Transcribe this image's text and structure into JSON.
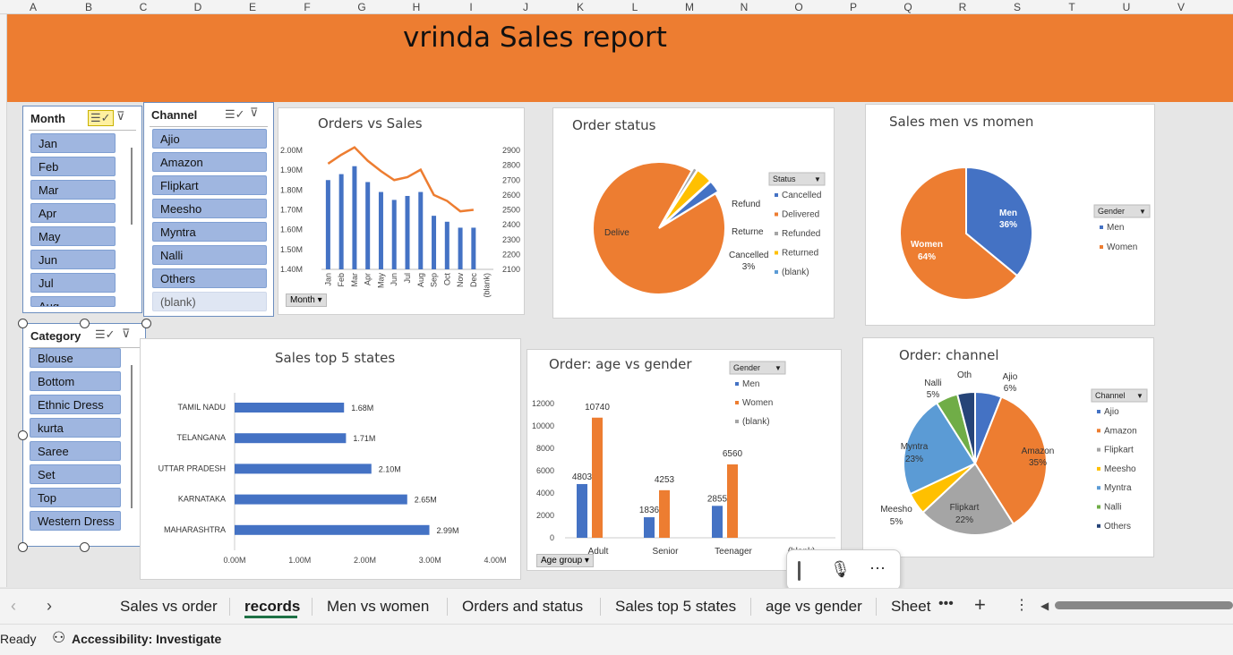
{
  "columns": [
    "A",
    "B",
    "C",
    "D",
    "E",
    "F",
    "G",
    "H",
    "I",
    "J",
    "K",
    "L",
    "M",
    "N",
    "O",
    "P",
    "Q",
    "R",
    "S",
    "T",
    "U",
    "V"
  ],
  "title": "vrinda Sales report",
  "slicers": {
    "month": {
      "title": "Month",
      "items": [
        "Jan",
        "Feb",
        "Mar",
        "Apr",
        "May",
        "Jun",
        "Jul",
        "Aug"
      ]
    },
    "channel": {
      "title": "Channel",
      "items": [
        "Ajio",
        "Amazon",
        "Flipkart",
        "Meesho",
        "Myntra",
        "Nalli",
        "Others"
      ],
      "blank": "(blank)"
    },
    "category": {
      "title": "Category",
      "items": [
        "Blouse",
        "Bottom",
        "Ethnic Dress",
        "kurta",
        "Saree",
        "Set",
        "Top",
        "Western Dress"
      ]
    }
  },
  "charts": {
    "orders_vs_sales": {
      "title": "Orders vs Sales",
      "field_button": "Month",
      "chart_data": {
        "type": "bar",
        "categories": [
          "Jan",
          "Feb",
          "Mar",
          "Apr",
          "May",
          "Jun",
          "Jul",
          "Aug",
          "Sep",
          "Oct",
          "Nov",
          "Dec",
          "(blank)"
        ],
        "series": [
          {
            "values": [
              1.85,
              1.88,
              1.92,
              1.84,
              1.79,
              1.75,
              1.77,
              1.79,
              1.67,
              1.64,
              1.61,
              1.61,
              0
            ]
          },
          {
            "values": [
              2810,
              2870,
              2920,
              2830,
              2760,
              2700,
              2720,
              2770,
              2600,
              2560,
              2490,
              2500,
              0
            ]
          }
        ],
        "y_ticks": [
          "2.00M",
          "1.90M",
          "1.80M",
          "1.70M",
          "1.60M",
          "1.50M",
          "1.40M"
        ],
        "y2_ticks": [
          "2900",
          "2800",
          "2700",
          "2600",
          "2500",
          "2400",
          "2300",
          "2200",
          "2100"
        ],
        "ylim": [
          1.4,
          2.0
        ],
        "y2lim": [
          2100,
          2900
        ]
      }
    },
    "order_status": {
      "title": "Order status",
      "legend_title": "Status",
      "legend": [
        "Cancelled",
        "Delivered",
        "Refunded",
        "Returned",
        "(blank)"
      ],
      "chart_data": {
        "type": "pie",
        "labels": [
          "Delivered",
          "Refunded",
          "Returned",
          "Cancelled"
        ],
        "values": [
          92,
          1,
          4,
          3
        ],
        "data_labels": [
          "Delive",
          "Refund",
          "Returne",
          "Cancelled",
          "3%"
        ]
      }
    },
    "sales_gender": {
      "title": "Sales men vs momen",
      "legend_title": "Gender",
      "legend": [
        "Men",
        "Women"
      ],
      "chart_data": {
        "type": "pie",
        "labels": [
          "Men",
          "Women"
        ],
        "values": [
          36,
          64
        ],
        "data_labels": [
          "Men",
          "36%",
          "Women",
          "64%"
        ]
      }
    },
    "top_states": {
      "title": "Sales top 5 states",
      "chart_data": {
        "type": "bar",
        "categories": [
          "TAMIL NADU",
          "TELANGANA",
          "UTTAR PRADESH",
          "KARNATAKA",
          "MAHARASHTRA"
        ],
        "values": [
          1.68,
          1.71,
          2.1,
          2.65,
          2.99
        ],
        "data_labels": [
          "1.68M",
          "1.71M",
          "2.10M",
          "2.65M",
          "2.99M"
        ],
        "x_ticks": [
          "0.00M",
          "1.00M",
          "2.00M",
          "3.00M",
          "4.00M"
        ],
        "xlim": [
          0,
          4
        ]
      }
    },
    "age_gender": {
      "title": "Order: age vs gender",
      "legend_title": "Gender",
      "legend": [
        "Men",
        "Women",
        "(blank)"
      ],
      "field_button": "Age group",
      "chart_data": {
        "type": "bar",
        "categories": [
          "Adult",
          "Senior",
          "Teenager",
          "(blank)"
        ],
        "series": [
          {
            "name": "Men",
            "values": [
              4803,
              1836,
              2855,
              0
            ]
          },
          {
            "name": "Women",
            "values": [
              10740,
              4253,
              6560,
              0
            ]
          }
        ],
        "y_ticks": [
          "12000",
          "10000",
          "8000",
          "6000",
          "4000",
          "2000",
          "0"
        ],
        "ylim": [
          0,
          12000
        ]
      }
    },
    "order_channel": {
      "title": "Order: channel",
      "legend_title": "Channel",
      "legend": [
        "Ajio",
        "Amazon",
        "Flipkart",
        "Meesho",
        "Myntra",
        "Nalli",
        "Others"
      ],
      "chart_data": {
        "type": "pie",
        "labels": [
          "Ajio",
          "Amazon",
          "Flipkart",
          "Meesho",
          "Myntra",
          "Nalli",
          "Others"
        ],
        "values": [
          6,
          35,
          22,
          5,
          23,
          5,
          4
        ],
        "data_labels": [
          "Ajio",
          "6%",
          "Amazon",
          "35%",
          "Flipkart",
          "22%",
          "Meesho",
          "5%",
          "Myntra",
          "23%",
          "Nalli",
          "5%",
          "Oth"
        ]
      }
    }
  },
  "sheet_tabs": [
    "Sales vs order",
    "records",
    "Men vs women",
    "Orders and status",
    "Sales top 5 states",
    "age vs gender",
    "Sheet"
  ],
  "active_tab": "records",
  "status_bar": {
    "ready": "Ready",
    "accessibility": "Accessibility: Investigate"
  },
  "colors": {
    "blue": "#4472c4",
    "orange": "#ed7d31",
    "gray": "#a5a5a5",
    "yellow": "#ffc000",
    "light_blue": "#5b9bd5",
    "green": "#70ad47",
    "navy": "#264478"
  }
}
